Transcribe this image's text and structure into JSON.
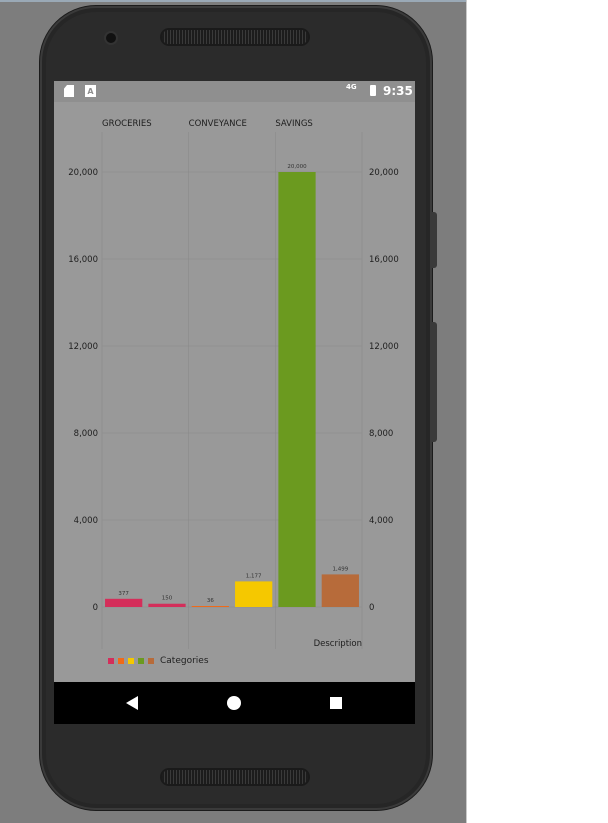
{
  "status_bar": {
    "time": "9:35",
    "network": "4G"
  },
  "chart_data": {
    "type": "bar",
    "column_headers": [
      "GROCERIES",
      "CONVEYANCE",
      "SAVINGS"
    ],
    "bars": [
      {
        "value": 377,
        "label": "377",
        "color": "#d42e5a"
      },
      {
        "value": 150,
        "label": "150",
        "color": "#d42e5a"
      },
      {
        "value": 36,
        "label": "36",
        "color": "#ef6a19"
      },
      {
        "value": 1177,
        "label": "1,177",
        "color": "#f5c800"
      },
      {
        "value": 20000,
        "label": "20,000",
        "color": "#6b9a1f"
      },
      {
        "value": 1499,
        "label": "1,499",
        "color": "#b76b3a"
      }
    ],
    "ylim": [
      0,
      20000
    ],
    "yticks": [
      0,
      4000,
      8000,
      12000,
      16000,
      20000
    ],
    "ytick_labels": [
      "0",
      "4,000",
      "8,000",
      "12,000",
      "16,000",
      "20,000"
    ],
    "xlabel": "Description",
    "legend": {
      "label": "Categories",
      "swatches": [
        "#d42e5a",
        "#ef6a19",
        "#f5c800",
        "#6b9a1f",
        "#b76b3a"
      ],
      "placement": "bottom-left"
    },
    "grid": true
  }
}
